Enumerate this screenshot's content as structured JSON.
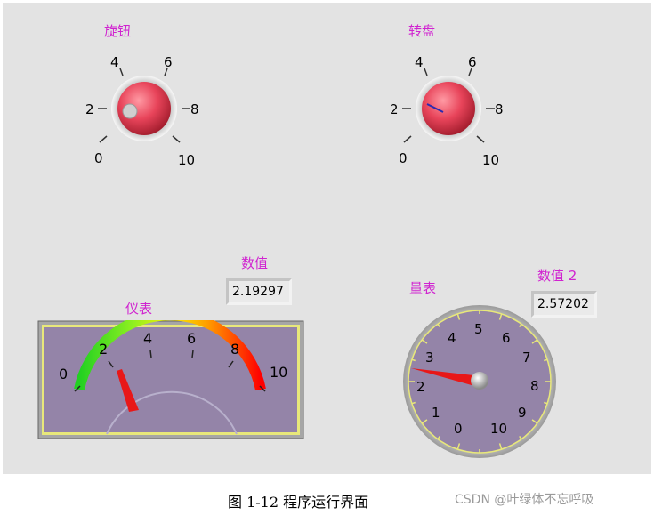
{
  "knob": {
    "label": "旋钮",
    "scale": [
      "0",
      "2",
      "4",
      "6",
      "8",
      "10"
    ]
  },
  "dial": {
    "label": "转盘",
    "scale": [
      "0",
      "2",
      "4",
      "6",
      "8",
      "10"
    ]
  },
  "meter": {
    "label": "仪表",
    "scale": [
      "0",
      "2",
      "4",
      "6",
      "8",
      "10"
    ],
    "value": 2.19297
  },
  "numeric1": {
    "label": "数值",
    "value": "2.19297"
  },
  "gauge": {
    "label": "量表",
    "scale": [
      "0",
      "1",
      "2",
      "3",
      "4",
      "5",
      "6",
      "7",
      "8",
      "9",
      "10"
    ],
    "value": 2.57202
  },
  "numeric2": {
    "label": "数值 2",
    "value": "2.57202"
  },
  "caption": "图 1-12  程序运行界面",
  "watermark": "CSDN @叶绿体不忘呼吸",
  "colors": {
    "label": "#d023d0",
    "knob": "#e8445a",
    "meter_face": "#9484a8",
    "meter_frame": "#e8e87a"
  }
}
